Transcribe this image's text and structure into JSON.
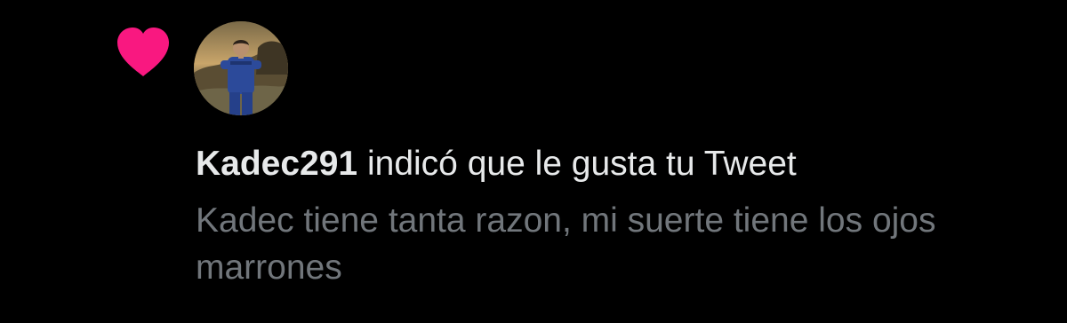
{
  "notification": {
    "type_icon": "heart-icon",
    "icon_color": "#f91880",
    "avatar_alt": "Kadec291 profile photo",
    "username": "Kadec291",
    "action_text": " indicó que le gusta tu Tweet",
    "tweet_text": "Kadec tiene tanta razon, mi suerte tiene los ojos marrones"
  },
  "colors": {
    "background": "#000000",
    "primary_text": "#e7e9ea",
    "secondary_text": "#71767b",
    "like_pink": "#f91880"
  }
}
